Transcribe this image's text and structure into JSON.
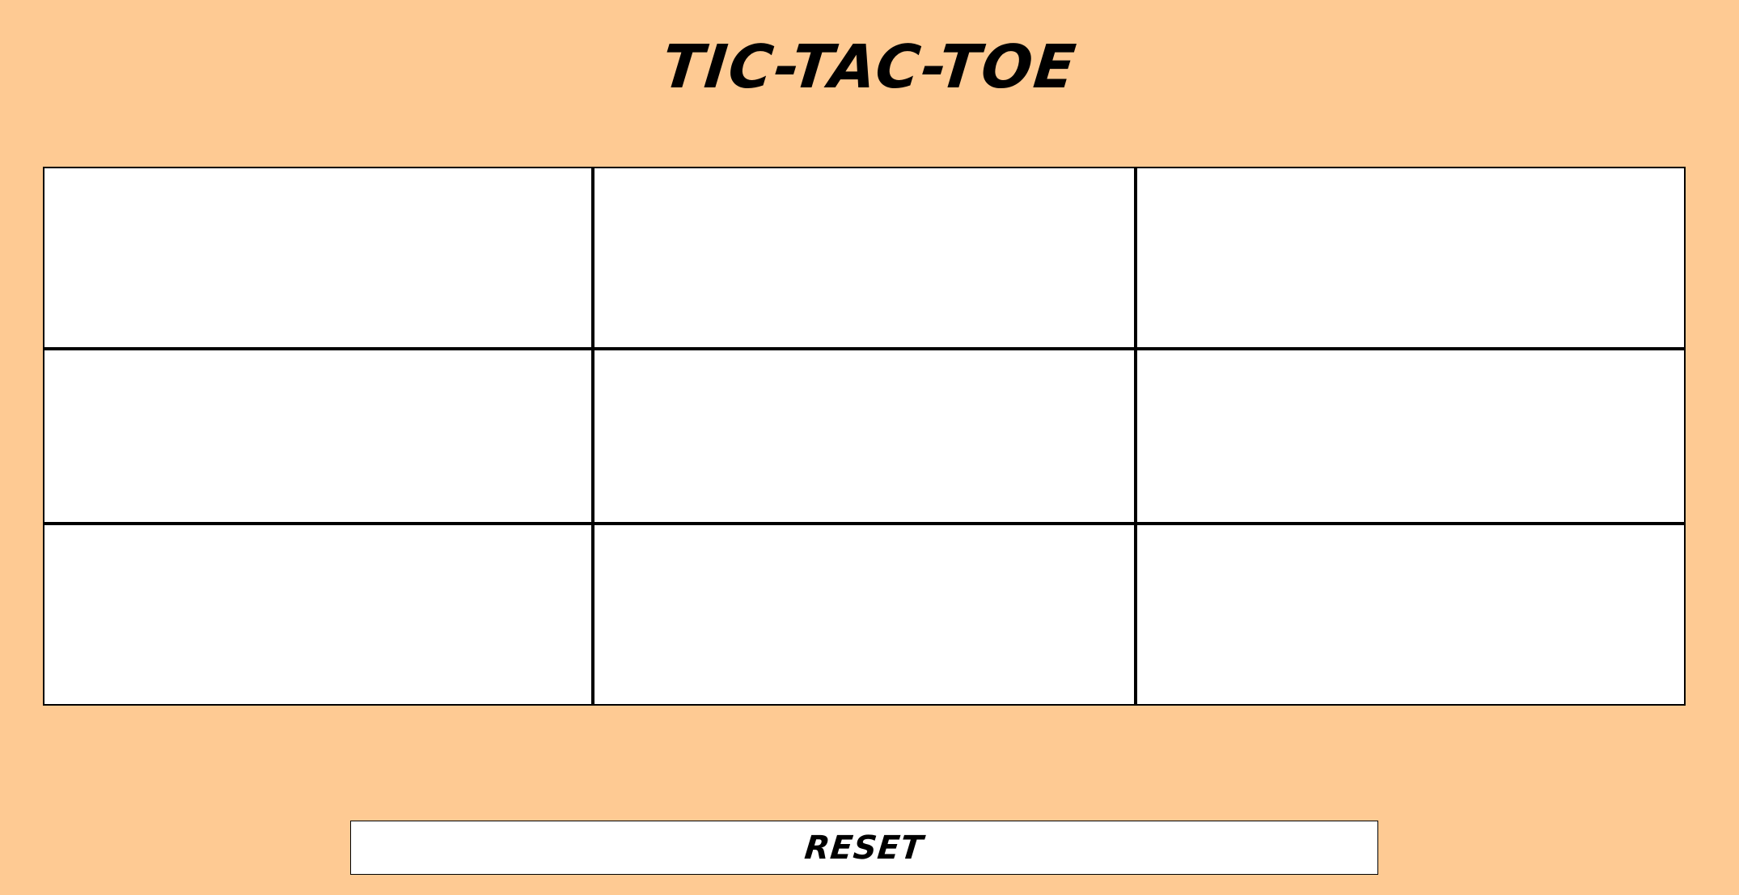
{
  "title": "TIC-TAC-TOE",
  "board": {
    "cells": [
      "",
      "",
      "",
      "",
      "",
      "",
      "",
      "",
      ""
    ]
  },
  "reset_label": "RESET",
  "colors": {
    "background": "#FECA93",
    "board": "#FFFFFF",
    "lines": "#000000"
  }
}
